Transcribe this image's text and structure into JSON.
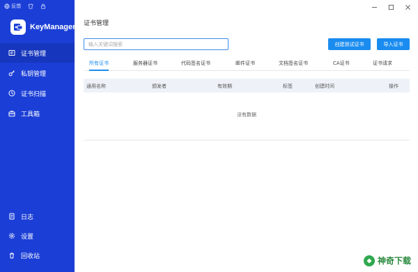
{
  "topbar": {
    "feedback_label": "反馈"
  },
  "brand": {
    "name": "KeyManager"
  },
  "sidebar": {
    "items": [
      {
        "label": "证书管理",
        "icon": "certificate-icon",
        "active": true
      },
      {
        "label": "私钥管理",
        "icon": "key-icon",
        "active": false
      },
      {
        "label": "证书扫描",
        "icon": "clock-icon",
        "active": false
      },
      {
        "label": "工具箱",
        "icon": "toolbox-icon",
        "active": false
      }
    ],
    "bottom_items": [
      {
        "label": "日志",
        "icon": "log-icon"
      },
      {
        "label": "设置",
        "icon": "gear-icon"
      },
      {
        "label": "回收站",
        "icon": "trash-icon"
      }
    ]
  },
  "main": {
    "title": "证书管理",
    "search": {
      "placeholder": "输入关键词搜索",
      "value": ""
    },
    "buttons": {
      "create_test": "创建测试证书",
      "import": "导入证书"
    },
    "tabs": [
      {
        "label": "所有证书",
        "active": true
      },
      {
        "label": "服务器证书",
        "active": false
      },
      {
        "label": "代码签名证书",
        "active": false
      },
      {
        "label": "邮件证书",
        "active": false
      },
      {
        "label": "文档签名证书",
        "active": false
      },
      {
        "label": "CA证书",
        "active": false
      },
      {
        "label": "证书请求",
        "active": false
      }
    ],
    "table": {
      "columns": [
        "通用名称",
        "颁发者",
        "有效期",
        "标签",
        "创建时间",
        "操作"
      ],
      "empty_text": "没有数据"
    }
  },
  "watermark": {
    "text": "神奇下载"
  },
  "colors": {
    "sidebar_bg": "#1b3fd6",
    "sidebar_active": "#1636bd",
    "accent": "#1a8cf0"
  }
}
